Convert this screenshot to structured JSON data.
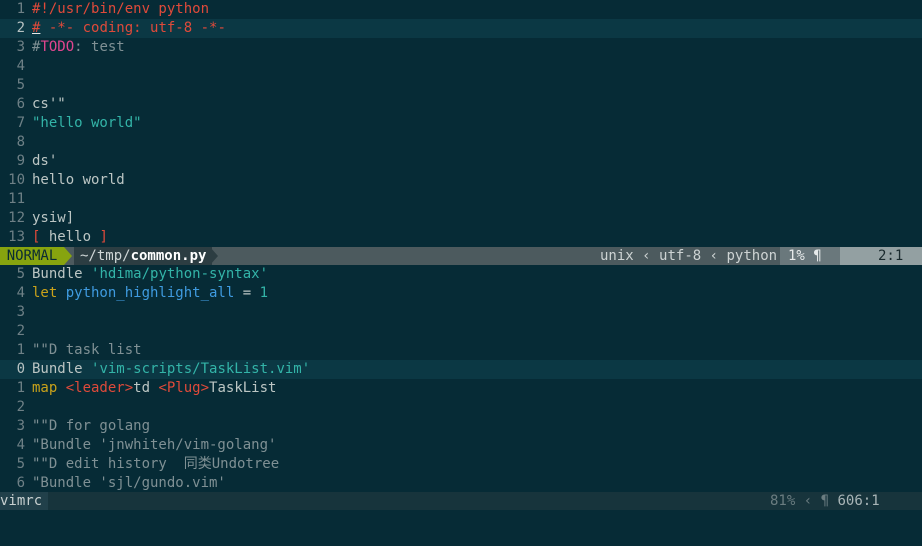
{
  "top_pane": {
    "lines": [
      {
        "n": "1",
        "segs": [
          {
            "t": "#!/usr/bin/env python",
            "c": "c-red"
          }
        ]
      },
      {
        "n": "2",
        "current": true,
        "segs": [
          {
            "t": "#",
            "c": "c-red cursor"
          },
          {
            "t": " -*- coding: utf-8 -*-",
            "c": "c-red"
          }
        ]
      },
      {
        "n": "3",
        "segs": [
          {
            "t": "#",
            "c": "c-grey"
          },
          {
            "t": "TODO",
            "c": "c-magenta"
          },
          {
            "t": ": test",
            "c": "c-grey"
          }
        ]
      },
      {
        "n": "4",
        "segs": []
      },
      {
        "n": "5",
        "segs": []
      },
      {
        "n": "6",
        "segs": [
          {
            "t": "cs'\"",
            "c": "c-text"
          }
        ]
      },
      {
        "n": "7",
        "segs": [
          {
            "t": "\"hello world\"",
            "c": "c-cyan"
          }
        ]
      },
      {
        "n": "8",
        "segs": []
      },
      {
        "n": "9",
        "segs": [
          {
            "t": "ds'",
            "c": "c-text"
          }
        ]
      },
      {
        "n": "10",
        "segs": [
          {
            "t": "hello world",
            "c": "c-text"
          }
        ]
      },
      {
        "n": "11",
        "segs": []
      },
      {
        "n": "12",
        "segs": [
          {
            "t": "ysiw]",
            "c": "c-text"
          }
        ]
      },
      {
        "n": "13",
        "segs": [
          {
            "t": "[",
            "c": "c-red"
          },
          {
            "t": " hello ",
            "c": "c-text"
          },
          {
            "t": "]",
            "c": "c-red"
          }
        ]
      }
    ]
  },
  "status": {
    "mode": "NORMAL",
    "path": "~/tmp/",
    "filename": "common.py",
    "fileformat": "unix",
    "sep": "‹",
    "encoding": "utf-8",
    "filetype": "python",
    "percent": "1%",
    "line_col": "2:1"
  },
  "bottom_pane": {
    "lines": [
      {
        "n": "5",
        "segs": [
          {
            "t": "Bundle ",
            "c": "c-text"
          },
          {
            "t": "'hdima/python-syntax'",
            "c": "c-cyan"
          }
        ]
      },
      {
        "n": "4",
        "segs": [
          {
            "t": "let ",
            "c": "c-yellow"
          },
          {
            "t": "python_highlight_all",
            "c": "c-blue"
          },
          {
            "t": " = ",
            "c": "c-text"
          },
          {
            "t": "1",
            "c": "c-cyan"
          }
        ]
      },
      {
        "n": "3",
        "segs": []
      },
      {
        "n": "2",
        "segs": []
      },
      {
        "n": "1",
        "segs": [
          {
            "t": "\"\"D task list",
            "c": "c-grey"
          }
        ]
      },
      {
        "n": "0",
        "current": true,
        "segs": [
          {
            "t": "Bundle ",
            "c": "c-text"
          },
          {
            "t": "'vim-scripts/TaskList.vim'",
            "c": "c-cyan"
          }
        ]
      },
      {
        "n": "1",
        "segs": [
          {
            "t": "map ",
            "c": "c-yellow"
          },
          {
            "t": "<leader>",
            "c": "c-red"
          },
          {
            "t": "td ",
            "c": "c-text"
          },
          {
            "t": "<Plug>",
            "c": "c-red"
          },
          {
            "t": "TaskList",
            "c": "c-text"
          }
        ]
      },
      {
        "n": "2",
        "segs": []
      },
      {
        "n": "3",
        "segs": [
          {
            "t": "\"\"D for golang",
            "c": "c-grey"
          }
        ]
      },
      {
        "n": "4",
        "segs": [
          {
            "t": "\"Bundle 'jnwhiteh/vim-golang'",
            "c": "c-grey"
          }
        ]
      },
      {
        "n": "5",
        "segs": [
          {
            "t": "\"\"D edit history  同类Undotree",
            "c": "c-grey"
          }
        ]
      },
      {
        "n": "6",
        "segs": [
          {
            "t": "\"Bundle 'sjl/gundo.vim'",
            "c": "c-grey"
          }
        ]
      }
    ]
  },
  "status2": {
    "filename": "vimrc",
    "percent": "81%",
    "sep": "‹",
    "line_col": "606:1"
  }
}
